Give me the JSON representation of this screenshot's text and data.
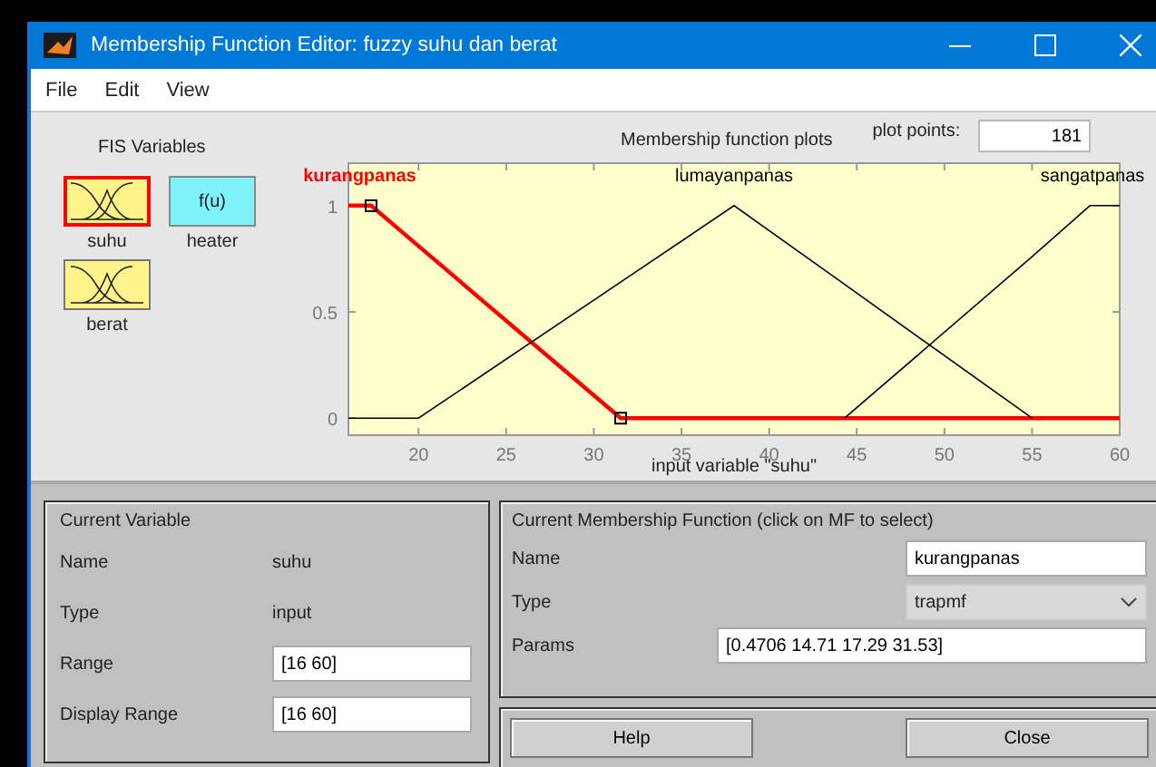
{
  "window": {
    "title": "Membership Function Editor: fuzzy suhu dan berat"
  },
  "menu": [
    "File",
    "Edit",
    "View"
  ],
  "fis_variables": {
    "title": "FIS Variables",
    "items": [
      {
        "name": "suhu",
        "kind": "mf",
        "selected": true
      },
      {
        "name": "heater",
        "kind": "fn",
        "symbol": "f(u)",
        "selected": false
      },
      {
        "name": "berat",
        "kind": "mf",
        "selected": false
      }
    ]
  },
  "plot_points": {
    "label": "plot points:",
    "value": "181"
  },
  "plot": {
    "chart_data": {
      "type": "line",
      "title": "Membership function plots",
      "xlabel": "input variable \"suhu\"",
      "x": [
        16,
        17.29,
        20,
        31.53,
        38,
        44.3,
        55,
        58.3,
        60
      ],
      "series": [
        {
          "name": "kurangpanas",
          "color": "#ff0000",
          "values": [
            1,
            1,
            0.81,
            0,
            0,
            0,
            0,
            0,
            0
          ]
        },
        {
          "name": "lumayanpanas",
          "color": "#000000",
          "values": [
            0,
            0,
            0,
            0.64,
            1,
            0.63,
            0,
            null,
            null
          ]
        },
        {
          "name": "sangatpanas",
          "color": "#000000",
          "values": [
            null,
            null,
            null,
            null,
            null,
            0,
            0.76,
            1,
            1
          ]
        }
      ],
      "xlim": [
        16,
        60
      ],
      "ylim": [
        -0.08,
        1.2
      ],
      "xticks": [
        20,
        25,
        30,
        35,
        40,
        45,
        50,
        55,
        60
      ],
      "yticks": [
        0,
        0.5,
        1
      ]
    }
  },
  "current_variable": {
    "title": "Current Variable",
    "rows": [
      {
        "label": "Name",
        "value": "suhu",
        "kind": "text"
      },
      {
        "label": "Type",
        "value": "input",
        "kind": "text"
      },
      {
        "label": "Range",
        "value": "[16 60]",
        "kind": "input"
      },
      {
        "label": "Display Range",
        "value": "[16 60]",
        "kind": "input"
      }
    ]
  },
  "current_mf": {
    "title": "Current Membership Function (click on MF to select)",
    "rows": [
      {
        "label": "Name",
        "value": "kurangpanas",
        "kind": "input"
      },
      {
        "label": "Type",
        "value": "trapmf",
        "kind": "select"
      },
      {
        "label": "Params",
        "value": "[0.4706 14.71 17.29 31.53]",
        "kind": "wide"
      }
    ]
  },
  "buttons": [
    "Help",
    "Close"
  ]
}
